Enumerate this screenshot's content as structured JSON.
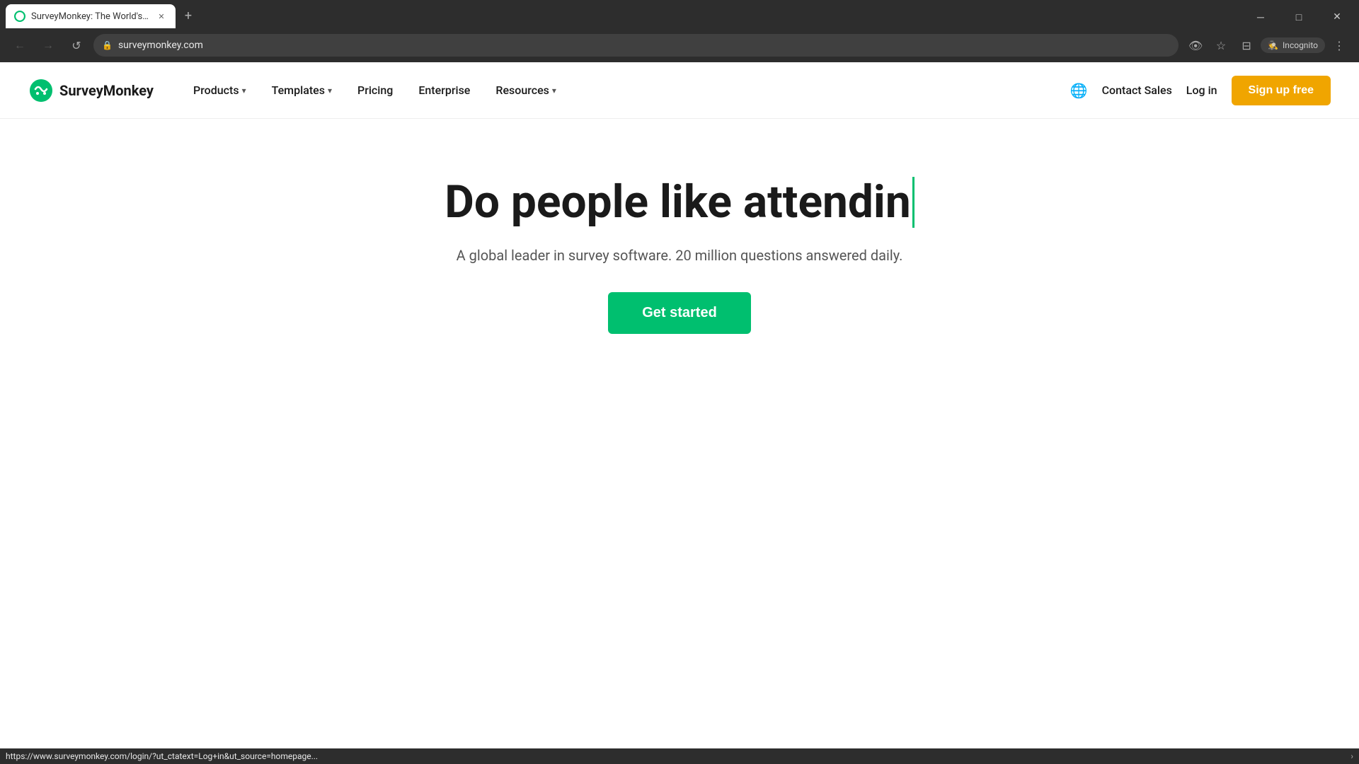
{
  "browser": {
    "tab_title": "SurveyMonkey: The World's M...",
    "tab_url": "surveymonkey.com",
    "tab_favicon": "🐒",
    "window_controls": {
      "minimize": "─",
      "maximize": "□",
      "close": "✕"
    },
    "nav_buttons": {
      "back": "←",
      "forward": "→",
      "refresh": "↺"
    },
    "browser_actions": {
      "incognito_label": "Incognito"
    }
  },
  "status_bar": {
    "url": "https://www.surveymonkey.com/login/?ut_ctatext=Log+in&ut_source=homepage...",
    "expand": "›"
  },
  "nav": {
    "logo_text": "SurveyMonkey",
    "items": [
      {
        "label": "Products",
        "has_dropdown": true
      },
      {
        "label": "Templates",
        "has_dropdown": true
      },
      {
        "label": "Pricing",
        "has_dropdown": false
      },
      {
        "label": "Enterprise",
        "has_dropdown": false
      },
      {
        "label": "Resources",
        "has_dropdown": true
      }
    ],
    "contact_sales": "Contact Sales",
    "login": "Log in",
    "signup": "Sign up free"
  },
  "hero": {
    "title": "Do people like attendin",
    "subtitle": "A global leader in survey software. 20 million questions answered daily.",
    "cta": "Get started"
  }
}
